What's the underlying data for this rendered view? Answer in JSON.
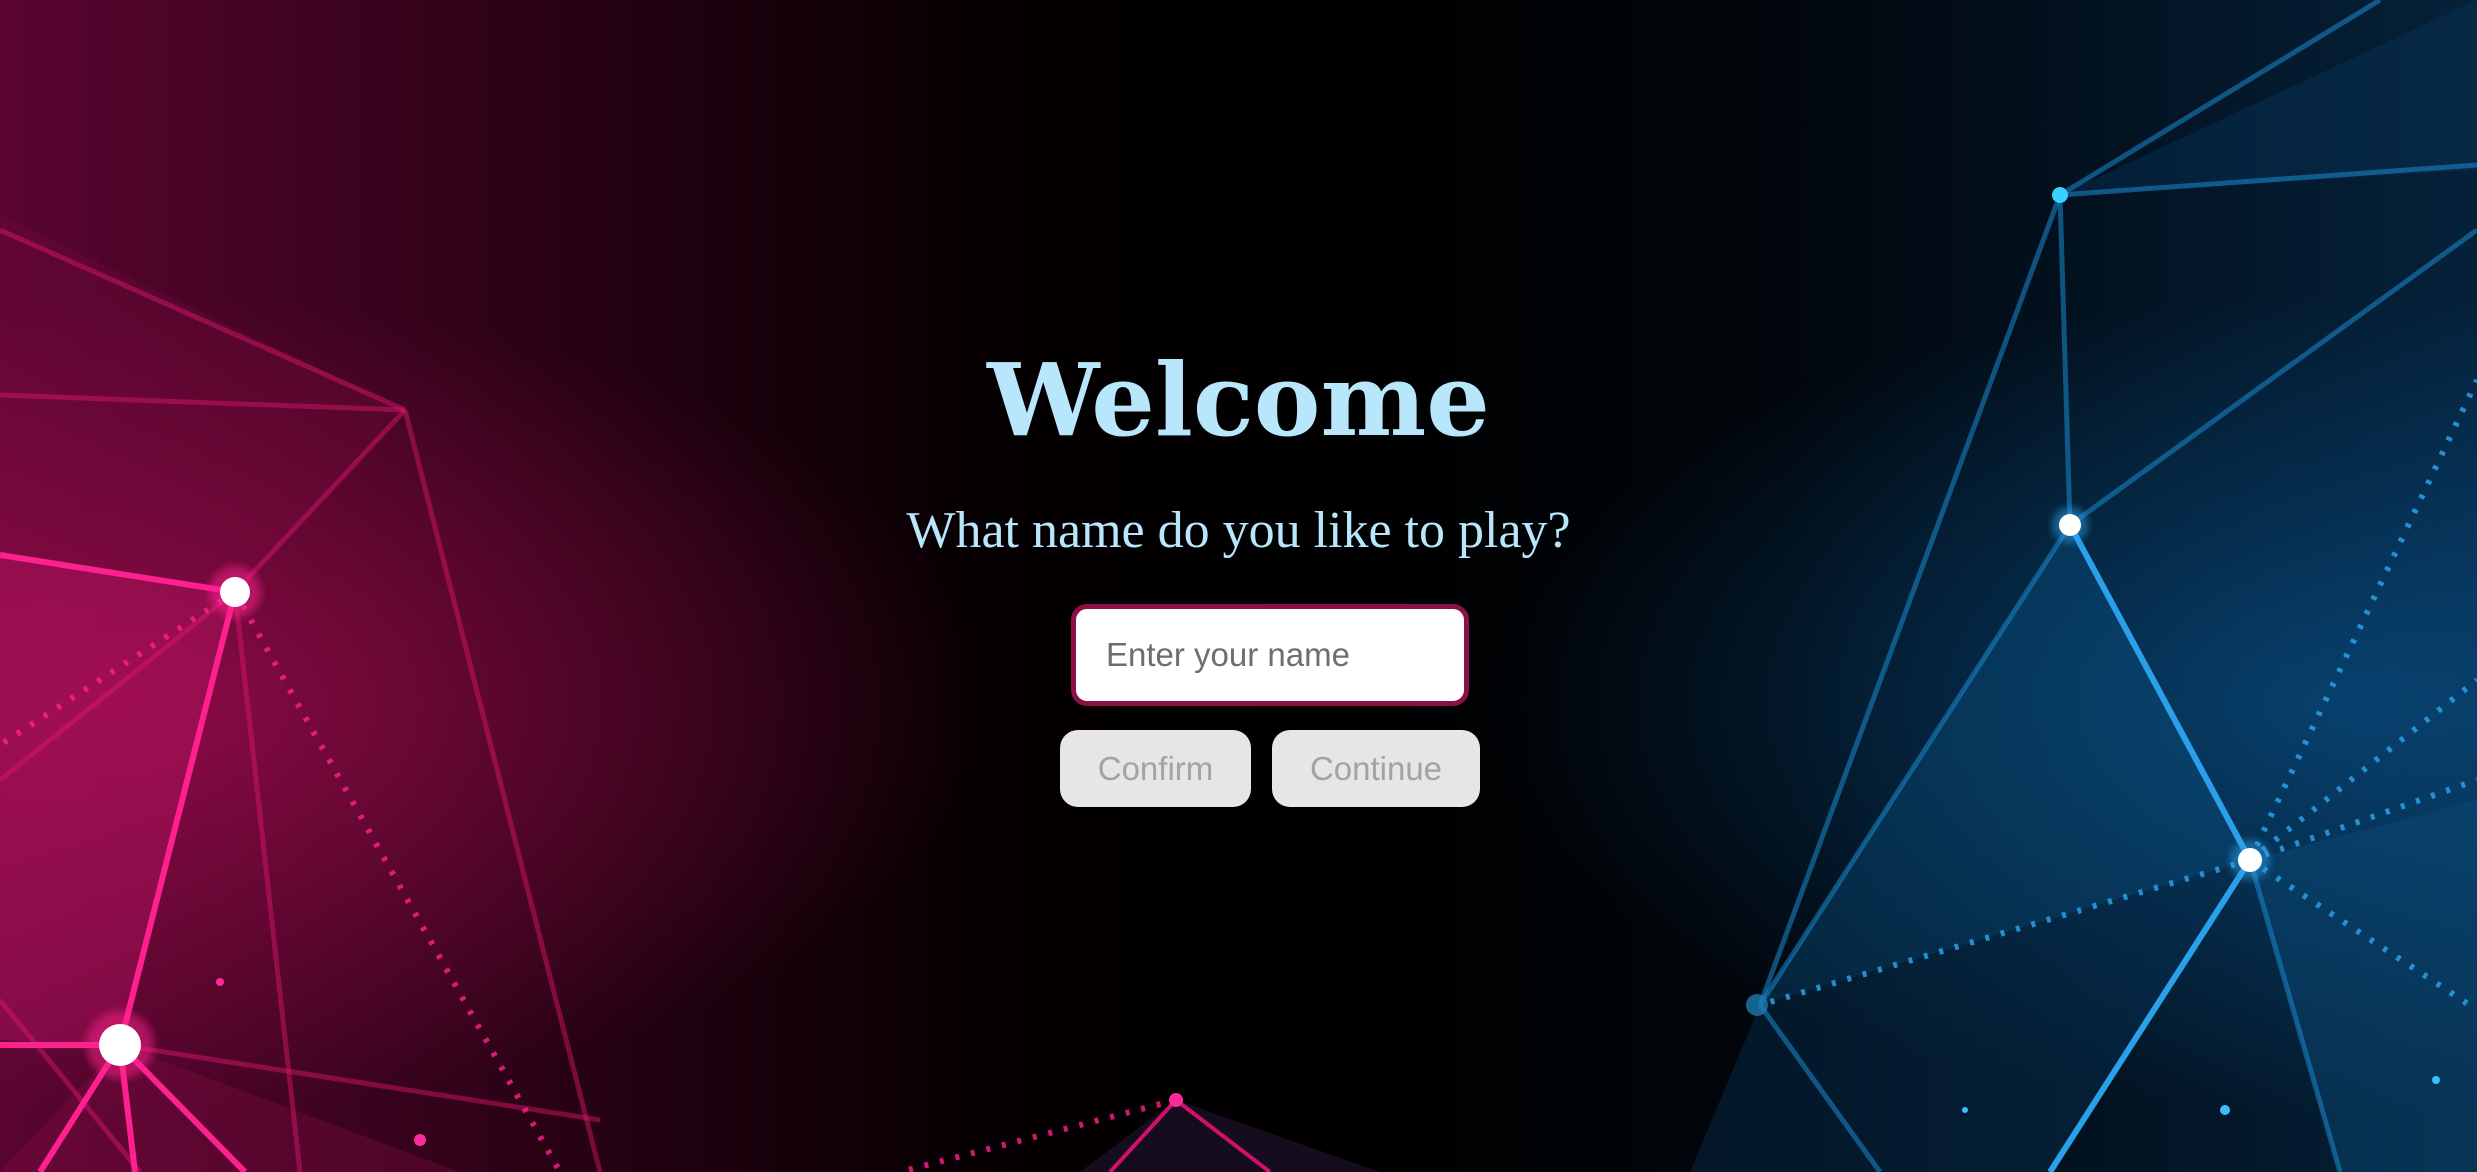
{
  "welcome": {
    "title": "Welcome",
    "prompt": "What name do you like to play?",
    "name_input": {
      "value": "",
      "placeholder": "Enter your name"
    },
    "confirm_label": "Confirm",
    "continue_label": "Continue"
  },
  "theme": {
    "heading_color": "#b8e6fb",
    "input_border_color": "#8c1048",
    "button_bg": "#e6e6e6",
    "button_text": "#a3a3a3",
    "left_accent": "#ff1a8c",
    "right_accent": "#1a9be0"
  },
  "decor": {
    "background_icon": "network-mesh-icon"
  }
}
